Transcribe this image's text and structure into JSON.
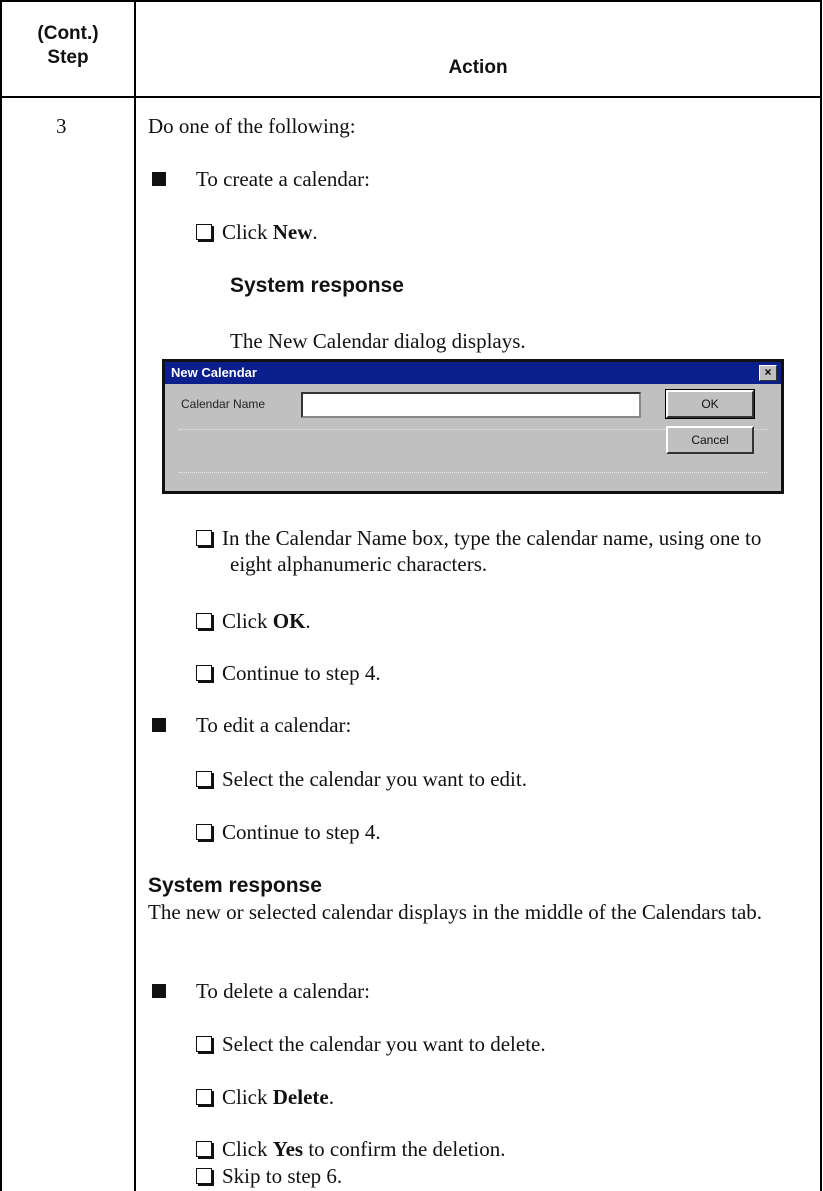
{
  "header": {
    "step_col_line1": "(Cont.)",
    "step_col_line2": "Step",
    "action_col": "Action"
  },
  "step_number": "3",
  "intro": "Do one of the following:",
  "create": {
    "label": "To create a calendar:",
    "click_prefix": "Click ",
    "click_bold": "New",
    "click_suffix": ".",
    "response_heading": "System response",
    "response_text": "The New Calendar dialog displays.",
    "name_instruction": "In the Calendar Name box, type the calendar name, using one to eight alphanumeric characters.",
    "ok_prefix": "Click ",
    "ok_bold": "OK",
    "ok_suffix": ".",
    "continue": "Continue to step 4."
  },
  "dialog": {
    "title": "New Calendar",
    "close_glyph": "×",
    "field_label": "Calendar Name",
    "field_value": "",
    "ok_label": "OK",
    "cancel_label": "Cancel"
  },
  "edit": {
    "label": "To edit a calendar:",
    "select": "Select the calendar you want to edit.",
    "continue": "Continue to step 4."
  },
  "system_response": {
    "heading": "System response",
    "text": "The new or selected calendar displays in the middle of the Calendars tab."
  },
  "delete": {
    "label": "To delete a calendar:",
    "select": "Select the calendar you want to delete.",
    "click_prefix": "Click ",
    "click_bold": "Delete",
    "click_suffix": ".",
    "confirm_prefix": "Click ",
    "confirm_bold": "Yes",
    "confirm_suffix": " to confirm the deletion.",
    "skip": "Skip to step 6."
  }
}
